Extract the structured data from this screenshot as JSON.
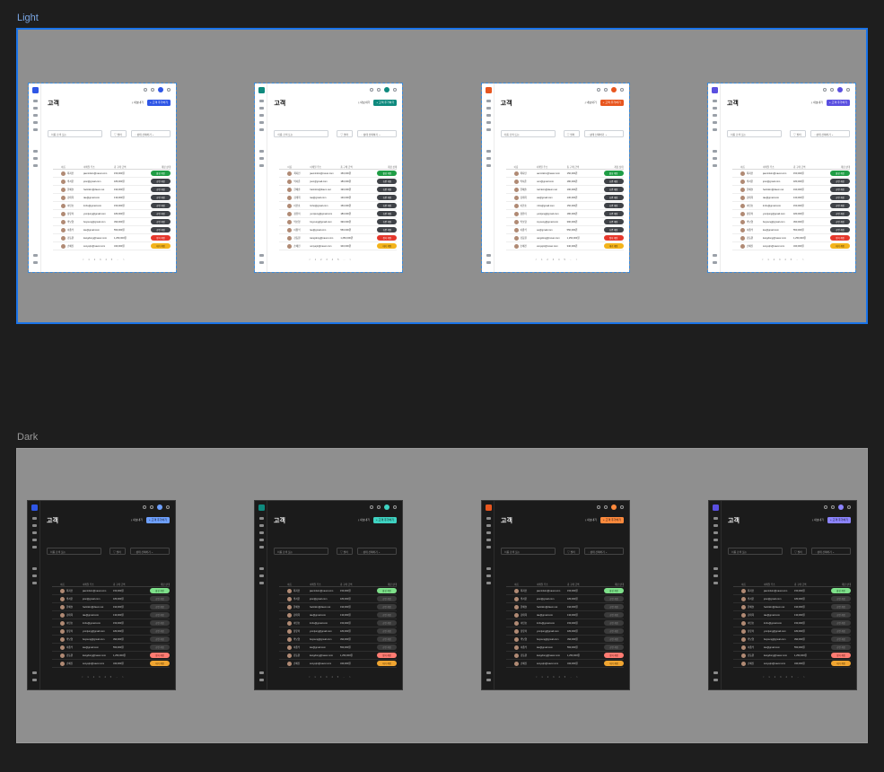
{
  "sections": {
    "light_label": "Light",
    "dark_label": "Dark"
  },
  "accents": [
    "#2f56e6",
    "#0f8a7e",
    "#e8561f",
    "#5a4fe0"
  ],
  "dark_accents": [
    "#6ea0ff",
    "#3fd3c2",
    "#ff8a3d",
    "#8c84ff"
  ],
  "screen": {
    "title": "고객",
    "export_label": "내보내기",
    "add_label": "고객 추가하기",
    "search_placeholder": "이름 검색 또는",
    "filter_label": "필터",
    "status_label": "상태 선택하기",
    "columns": [
      "이름",
      "이메일 주소",
      "총 구매 금액",
      "계정 상태"
    ],
    "pager": [
      "<",
      "1",
      "2",
      "3",
      "4",
      "5",
      "...",
      ">"
    ],
    "rows": [
      {
        "name": "최지민",
        "email": "jaeminkim@naver.com",
        "amount": "150,000원",
        "status": "활성 계정",
        "kind": "success"
      },
      {
        "name": "박서준",
        "email": "joon@gmail.com",
        "amount": "180,000원",
        "status": "휴면 계정",
        "kind": "neutral"
      },
      {
        "name": "한예슬",
        "email": "harinkim@daum.net",
        "amount": "190,000원",
        "status": "휴면 계정",
        "kind": "neutral"
      },
      {
        "name": "김태희",
        "email": "tae@gmail.com",
        "amount": "130,000원",
        "status": "휴면 계정",
        "kind": "neutral"
      },
      {
        "name": "이민호",
        "email": "lmho@gmail.com",
        "amount": "150,000원",
        "status": "휴면 계정",
        "kind": "neutral"
      },
      {
        "name": "정유미",
        "email": "yumijung@gmail.com",
        "amount": "180,000원",
        "status": "휴면 계정",
        "kind": "neutral"
      },
      {
        "name": "박보영",
        "email": "boyoung@gmail.com",
        "amount": "390,000원",
        "status": "휴면 계정",
        "kind": "neutral"
      },
      {
        "name": "이종석",
        "email": "lee@gmail.com",
        "amount": "550,000원",
        "status": "휴면 계정",
        "kind": "neutral"
      },
      {
        "name": "강동원",
        "email": "kangdong@naver.com",
        "amount": "1,250,000원",
        "status": "정지 계정",
        "kind": "danger"
      },
      {
        "name": "손예진",
        "email": "sonyejin@naver.com",
        "amount": "340,000원",
        "status": "대기 계정",
        "kind": "warning"
      }
    ]
  }
}
